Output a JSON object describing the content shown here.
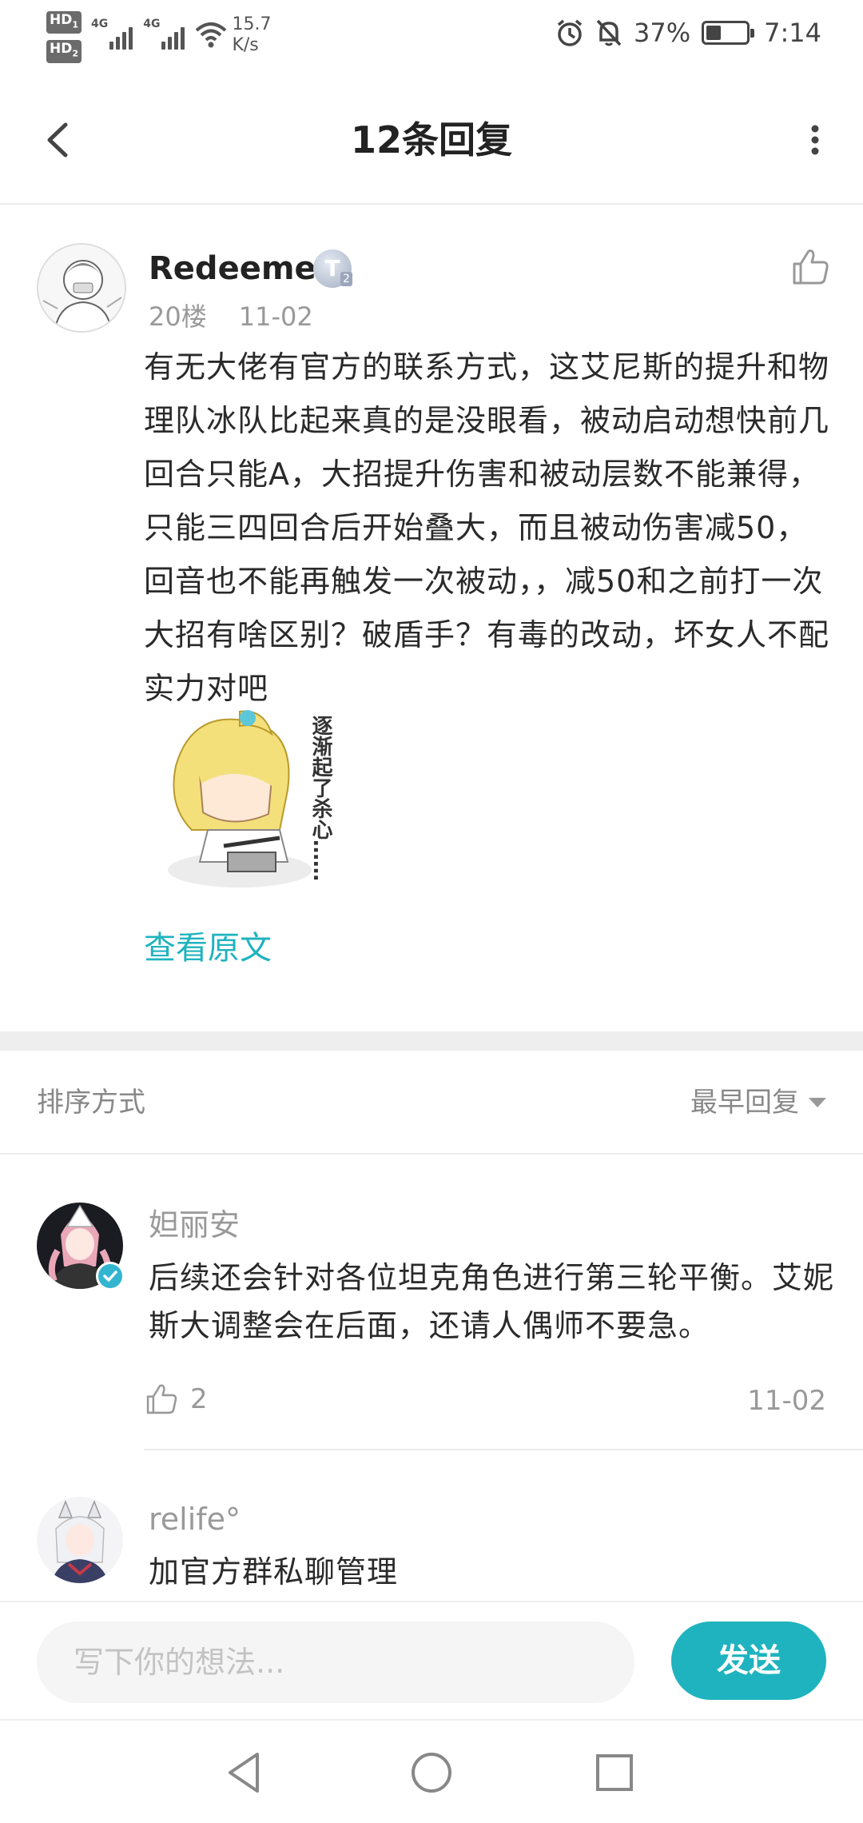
{
  "status_bar": {
    "hd1": "HD",
    "hd2": "HD",
    "net1": "4G",
    "net2": "4G",
    "speed_value": "15.7",
    "speed_unit": "K/s",
    "battery_percent": "37%",
    "battery_level": 0.37,
    "time": "7:14"
  },
  "header": {
    "title": "12条回复"
  },
  "post": {
    "author": "Redeemer",
    "level_badge": "T",
    "level_sub": "2",
    "floor": "20楼",
    "date": "11-02",
    "body": "有无大佬有官方的联系方式，这艾尼斯的提升和物理队冰队比起来真的是没眼看，被动启动想快前几回合只能A，大招提升伤害和被动层数不能兼得，只能三四回合后开始叠大，而且被动伤害减50，回音也不能再触发一次被动，，减50和之前打一次大招有啥区别？破盾手？有毒的改动，坏女人不配实力对吧",
    "sticker_text": "逐渐起了杀心……",
    "view_original": "查看原文"
  },
  "sort": {
    "label": "排序方式",
    "selected": "最早回复"
  },
  "replies": [
    {
      "name": "妲丽安",
      "text": "后续还会针对各位坦克角色进行第三轮平衡。艾妮斯大调整会在后面，还请人偶师不要急。",
      "likes": "2",
      "date": "11-02"
    },
    {
      "name": "relife°",
      "text": "加官方群私聊管理"
    }
  ],
  "comment": {
    "placeholder": "写下你的想法...",
    "send_label": "发送"
  },
  "colors": {
    "accent": "#1fb3bf",
    "verified": "#33b5d0"
  }
}
